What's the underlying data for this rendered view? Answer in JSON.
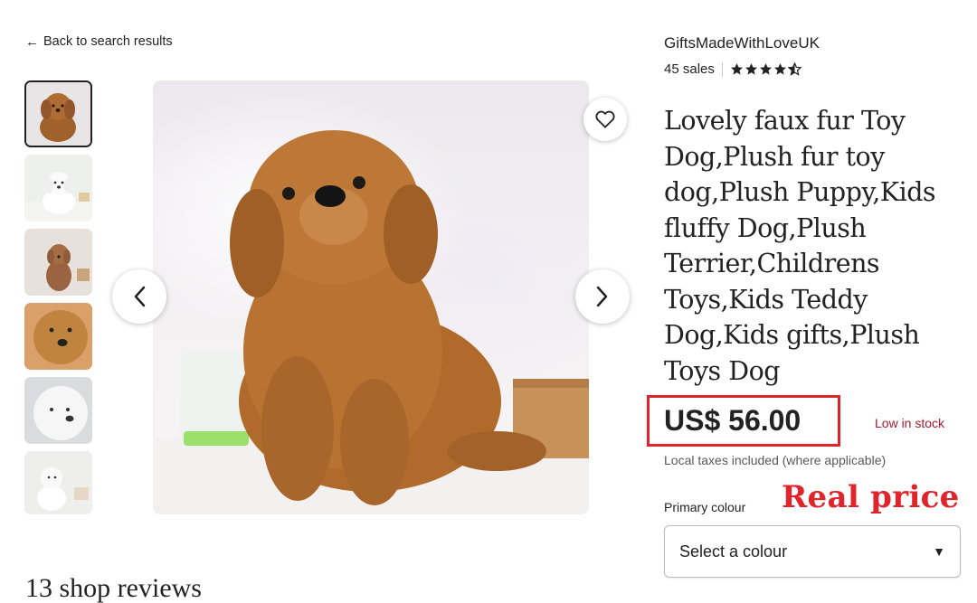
{
  "nav": {
    "back_label": "Back to search results"
  },
  "gallery": {
    "thumbnails": [
      "thumbnail-1",
      "thumbnail-2",
      "thumbnail-3",
      "thumbnail-4",
      "thumbnail-5",
      "thumbnail-6"
    ],
    "active_index": 0,
    "favorite_icon": "heart-icon",
    "prev_icon": "chevron-left-icon",
    "next_icon": "chevron-right-icon"
  },
  "shop": {
    "name": "GiftsMadeWithLoveUK",
    "sales": "45 sales",
    "rating": 4.5,
    "rating_max": 5
  },
  "product": {
    "title": "Lovely faux fur Toy Dog,Plush fur toy dog,Plush Puppy,Kids fluffy Dog,Plush Terrier,Childrens Toys,Kids Teddy Dog,Kids gifts,Plush Toys Dog",
    "price": "US$ 56.00",
    "stock_status": "Low in stock",
    "taxes_note": "Local taxes included (where applicable)"
  },
  "variation": {
    "label": "Primary colour",
    "selected": "Select a colour"
  },
  "annotation": {
    "text": "Real price"
  },
  "reviews": {
    "heading_partial": "13 shop reviews"
  },
  "colors": {
    "highlight_red": "#e0242b",
    "stock_red": "#a61a2e",
    "text": "#222222"
  }
}
